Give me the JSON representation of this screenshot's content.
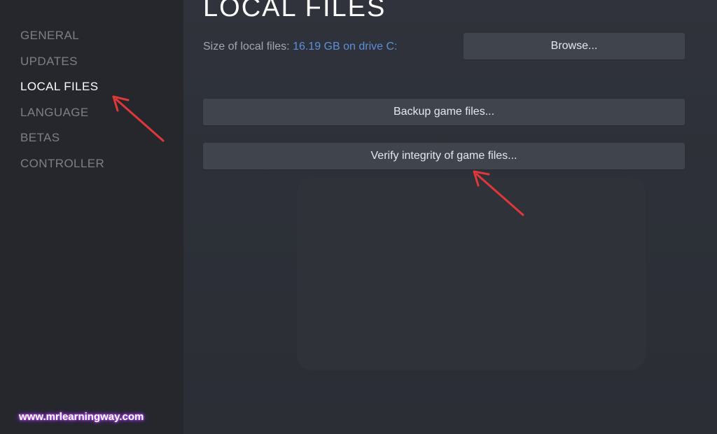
{
  "sidebar": {
    "items": [
      {
        "label": "GENERAL",
        "active": false
      },
      {
        "label": "UPDATES",
        "active": false
      },
      {
        "label": "LOCAL FILES",
        "active": true
      },
      {
        "label": "LANGUAGE",
        "active": false
      },
      {
        "label": "BETAS",
        "active": false
      },
      {
        "label": "CONTROLLER",
        "active": false
      }
    ]
  },
  "main": {
    "title": "LOCAL FILES",
    "size_label": "Size of local files:",
    "size_value": "16.19 GB on drive C:",
    "browse_label": "Browse...",
    "backup_label": "Backup game files...",
    "verify_label": "Verify integrity of game files..."
  },
  "annotation": {
    "arrow_color": "#e0383a"
  },
  "watermark": {
    "text": "www.mrlearningway.com"
  },
  "colors": {
    "sidebar_bg": "#25272d",
    "main_bg": "#2d3038",
    "button_bg": "#40444d",
    "link_blue": "#5b8fd8",
    "active_text": "#ffffff",
    "inactive_text": "#7c8086"
  }
}
